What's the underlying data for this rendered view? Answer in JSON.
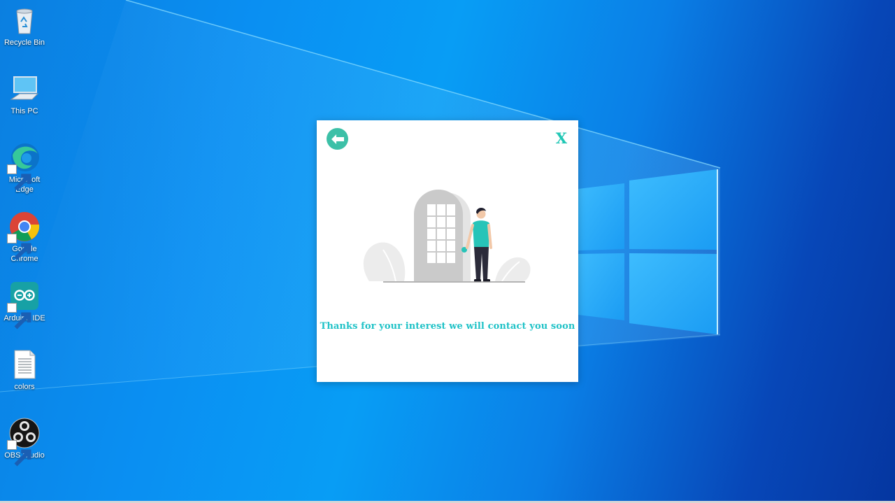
{
  "desktop": {
    "icons": [
      {
        "label": "Recycle Bin",
        "icon": "recycle-bin-icon",
        "shortcut": false
      },
      {
        "label": "This PC",
        "icon": "computer-icon",
        "shortcut": false
      },
      {
        "label": "Microsoft Edge",
        "icon": "edge-icon",
        "shortcut": true
      },
      {
        "label": "Google Chrome",
        "icon": "chrome-icon",
        "shortcut": true
      },
      {
        "label": "Arduino IDE",
        "icon": "arduino-icon",
        "shortcut": true
      },
      {
        "label": "colors",
        "icon": "text-file-icon",
        "shortcut": false
      },
      {
        "label": "OBS Studio",
        "icon": "obs-icon",
        "shortcut": true
      }
    ]
  },
  "dialog": {
    "back_icon": "arrow-left-icon",
    "close_label": "X",
    "illustration": "person-at-door-illustration",
    "message": "Thanks for your interest we will contact you soon",
    "accent_color": "#3cc0a7",
    "text_color": "#1fc2c7"
  }
}
